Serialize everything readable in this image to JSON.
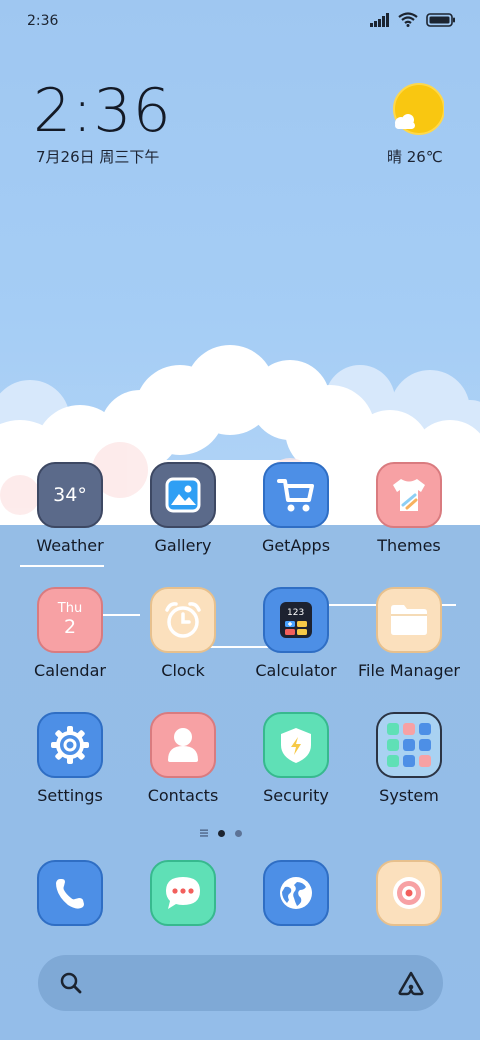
{
  "status_bar": {
    "time": "2:36",
    "icons": [
      "signal-icon",
      "wifi-icon",
      "battery-icon"
    ]
  },
  "clock_widget": {
    "time": "2:36",
    "date": "7月26日 周三下午"
  },
  "weather_widget": {
    "condition_icon": "sun-cloud-icon",
    "text": "晴 26℃"
  },
  "apps": {
    "weather": {
      "label": "Weather",
      "icon_text": "34°"
    },
    "gallery": {
      "label": "Gallery"
    },
    "getapps": {
      "label": "GetApps"
    },
    "themes": {
      "label": "Themes"
    },
    "calendar": {
      "label": "Calendar",
      "icon_day": "Thu",
      "icon_date": "2"
    },
    "clock": {
      "label": "Clock"
    },
    "calculator": {
      "label": "Calculator",
      "icon_display": "123"
    },
    "file_manager": {
      "label": "File Manager"
    },
    "settings": {
      "label": "Settings"
    },
    "contacts": {
      "label": "Contacts"
    },
    "security": {
      "label": "Security"
    },
    "system": {
      "label": "System"
    }
  },
  "dock": [
    "phone-icon",
    "messages-icon",
    "browser-icon",
    "camera-icon"
  ],
  "page_indicator": {
    "pages": 3,
    "active": 1
  },
  "search_bar": {
    "left_icon": "search-icon",
    "right_icon": "assistant-icon"
  },
  "colors": {
    "background": "#94bde9",
    "blue": "#4d8fe6",
    "pink": "#f7a1a4",
    "slate": "#5b6a8a",
    "cream": "#fbe0bd",
    "mint": "#5fe0b6"
  }
}
